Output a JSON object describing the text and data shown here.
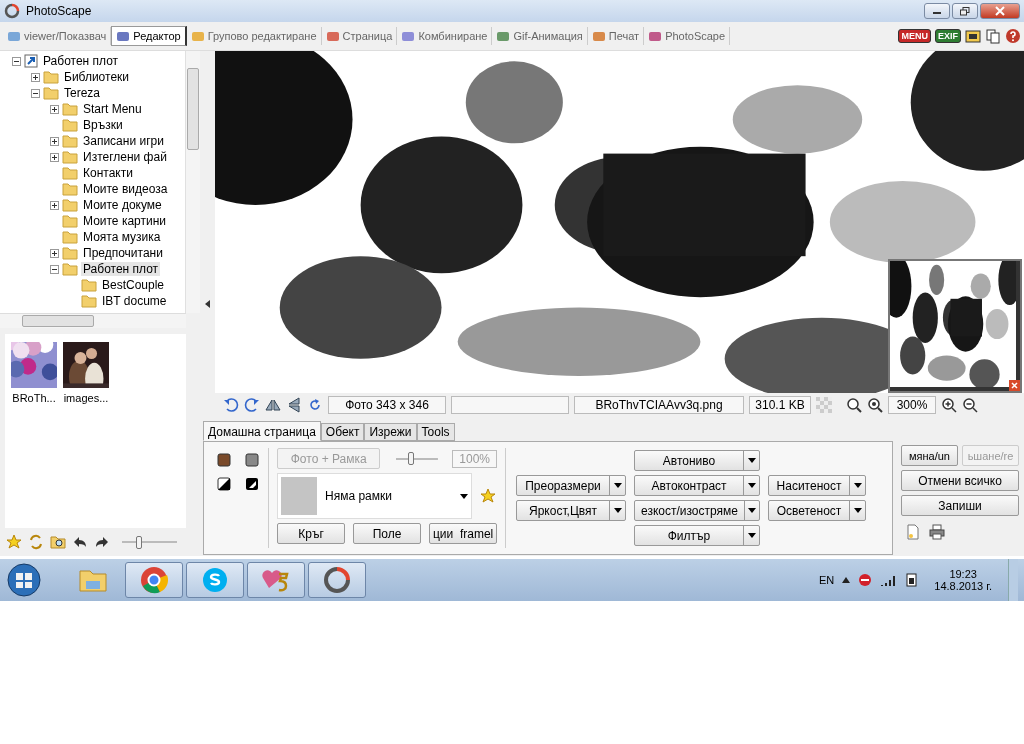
{
  "window": {
    "title": "PhotoScape"
  },
  "tabs": [
    {
      "label": "viewer/Показвач",
      "selected": false
    },
    {
      "label": "Редактор",
      "selected": true
    },
    {
      "label": "Групово редактиране",
      "selected": false
    },
    {
      "label": "Страница",
      "selected": false
    },
    {
      "label": "Комбиниране",
      "selected": false
    },
    {
      "label": "Gif-Анимация",
      "selected": false
    },
    {
      "label": "Печат",
      "selected": false
    },
    {
      "label": "PhotoScape",
      "selected": false
    }
  ],
  "top_icons": [
    {
      "kind": "badge",
      "label": "MENU",
      "color": "#c62828"
    },
    {
      "kind": "badge",
      "label": "EXIF",
      "color": "#2e7d32"
    },
    {
      "kind": "film"
    },
    {
      "kind": "copy"
    },
    {
      "kind": "help"
    }
  ],
  "tree": [
    {
      "label": "Работен плот",
      "expanded": true,
      "has_children": true,
      "selected": false,
      "children": [
        {
          "label": "Библиотеки",
          "expanded": false,
          "has_children": true,
          "selected": false
        },
        {
          "label": "Tereza",
          "expanded": true,
          "has_children": true,
          "selected": false,
          "children": [
            {
              "label": "Start Menu",
              "expanded": false,
              "has_children": true,
              "selected": false
            },
            {
              "label": "Връзки",
              "expanded": false,
              "has_children": false,
              "selected": false
            },
            {
              "label": "Записани игри",
              "expanded": false,
              "has_children": true,
              "selected": false
            },
            {
              "label": "Изтеглени фай",
              "expanded": false,
              "has_children": true,
              "selected": false
            },
            {
              "label": "Контакти",
              "expanded": false,
              "has_children": false,
              "selected": false
            },
            {
              "label": "Моите видеоза",
              "expanded": false,
              "has_children": false,
              "selected": false
            },
            {
              "label": "Моите докуме",
              "expanded": false,
              "has_children": true,
              "selected": false
            },
            {
              "label": "Моите картини",
              "expanded": false,
              "has_children": false,
              "selected": false
            },
            {
              "label": "Моята музика",
              "expanded": false,
              "has_children": false,
              "selected": false
            },
            {
              "label": "Предпочитани",
              "expanded": false,
              "has_children": true,
              "selected": false
            },
            {
              "label": "Работен плот",
              "expanded": true,
              "has_children": true,
              "selected": true,
              "children": [
                {
                  "label": "BestCouple",
                  "expanded": false,
                  "has_children": false,
                  "selected": false
                },
                {
                  "label": "IBT docume",
                  "expanded": false,
                  "has_children": false,
                  "selected": false
                }
              ]
            }
          ]
        }
      ]
    }
  ],
  "thumbnails": [
    {
      "caption": "BRoTh...",
      "kind": "picture"
    },
    {
      "caption": "images...",
      "kind": "picture"
    }
  ],
  "thumb_size_slider": {
    "level": 0.3
  },
  "status": {
    "photo_size": "Фото 343 x 346",
    "file_name": "BRoThvTCIAAvv3q.png",
    "file_size": "310.1 KB",
    "zoom": "300%"
  },
  "edit_tabs": [
    {
      "label": "Домашна страница",
      "selected": true
    },
    {
      "label": "Обект",
      "selected": false
    },
    {
      "label": "Изрежи",
      "selected": false
    },
    {
      "label": "Tools",
      "selected": false
    }
  ],
  "frame": {
    "photo_frame_button": "Фото + Рамка",
    "photo_frame_disabled": true,
    "slider": {
      "level": 0.35
    },
    "percent": "100%",
    "selection": "Няма рамки",
    "buttons": [
      "Кръг",
      "Поле",
      "ции  framel"
    ]
  },
  "adjust_columns": [
    [
      {
        "label": "Преоразмери"
      },
      {
        "label": "Яркост,Цвят"
      }
    ],
    [
      {
        "label": "Автониво"
      },
      {
        "label": "Автоконтраст"
      },
      {
        "label": "езкост/изостряме"
      },
      {
        "label": "Филтър"
      }
    ],
    [
      {
        "label": "Наситеност"
      },
      {
        "label": "Осветеност"
      }
    ]
  ],
  "actions": [
    {
      "label": "мяна/un",
      "disabled": false
    },
    {
      "label": "ьшане/re",
      "disabled": true
    },
    {
      "label": "Отмени всичко",
      "disabled": false
    },
    {
      "label": "Запиши",
      "disabled": false
    }
  ],
  "taskbar": {
    "apps": [
      {
        "kind": "explorer",
        "running": false
      },
      {
        "kind": "chrome",
        "running": true
      },
      {
        "kind": "skype",
        "running": true
      },
      {
        "kind": "five",
        "running": true
      },
      {
        "kind": "photoscape",
        "running": true
      }
    ],
    "language": "EN",
    "time": "19:23",
    "date": "14.8.2013 г."
  }
}
